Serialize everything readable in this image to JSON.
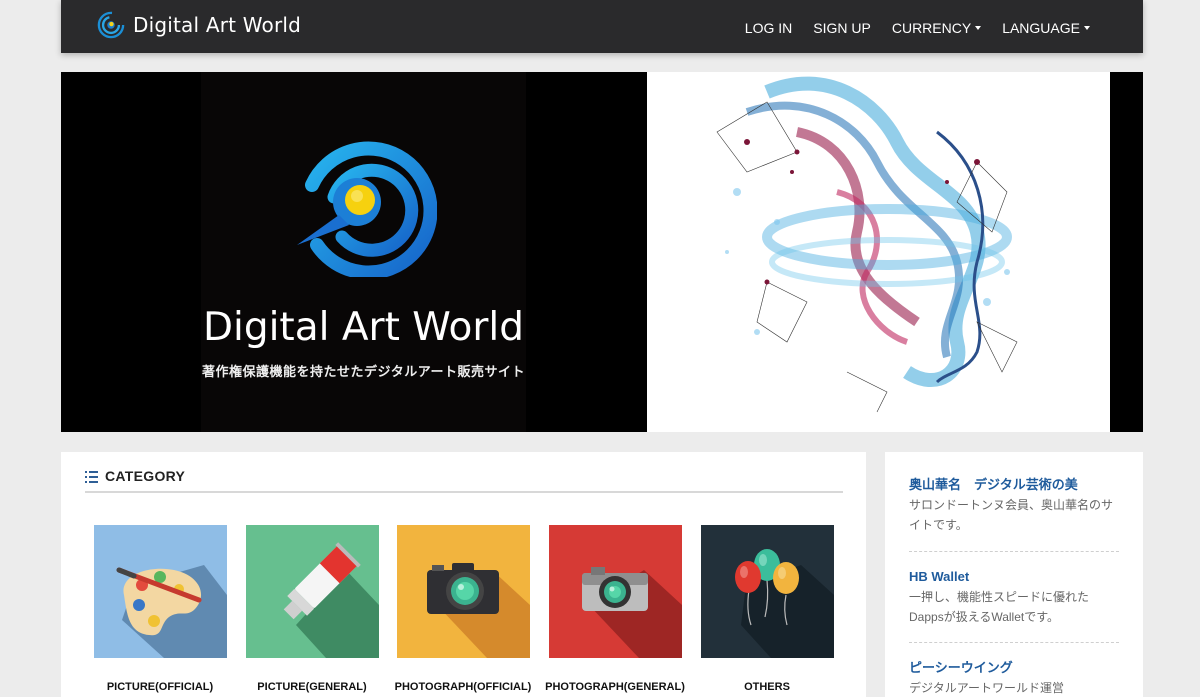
{
  "header": {
    "brand": "Digital Art World",
    "nav": {
      "login": "LOG IN",
      "signup": "SIGN UP",
      "currency": "CURRENCY",
      "language": "LANGUAGE"
    }
  },
  "hero": {
    "title": "Digital Art World",
    "subtitle": "著作権保護機能を持たせたデジタルアート販売サイト"
  },
  "category": {
    "title": "CATEGORY",
    "items": [
      {
        "label": "PICTURE(OFFICIAL)",
        "icon": "palette-icon",
        "color": "#8fbde6"
      },
      {
        "label": "PICTURE(GENERAL)",
        "icon": "paint-tube-icon",
        "color": "#66bf8f"
      },
      {
        "label": "PHOTOGRAPH(OFFICIAL)",
        "icon": "camera-icon",
        "color": "#f2b43e"
      },
      {
        "label": "PHOTOGRAPH(GENERAL)",
        "icon": "camera-icon",
        "color": "#d63a35"
      },
      {
        "label": "OTHERS",
        "icon": "balloons-icon",
        "color": "#22303a"
      }
    ]
  },
  "sidebar": {
    "items": [
      {
        "title": "奥山華名　デジタル芸術の美",
        "desc": "サロンドートンヌ会員、奥山華名のサイトです。"
      },
      {
        "title": "HB Wallet",
        "desc": "一押し、機能性スピードに優れたDappsが扱えるWalletです。"
      },
      {
        "title": "ピーシーウイング",
        "desc": "デジタルアートワールド運営"
      }
    ]
  },
  "colors": {
    "navbar": "#2a2a2c",
    "link": "#1f5b9c",
    "page_bg": "#ececec"
  }
}
